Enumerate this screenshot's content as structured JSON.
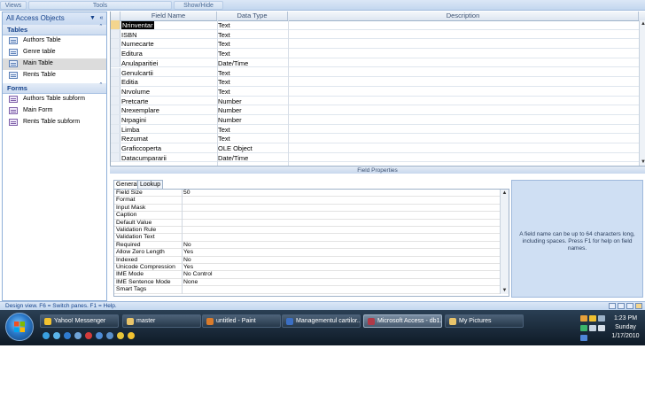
{
  "ribbon": {
    "groups": [
      "Views",
      "Tools",
      "Show/Hide"
    ]
  },
  "nav": {
    "title": "All Access Objects",
    "dropdown_icon": "chevron-down-icon",
    "collapse_icon": "double-chevron-left-icon",
    "groups": [
      {
        "label": "Tables",
        "items": [
          "Authors Table",
          "Genre table",
          "Main Table",
          "Rents Table"
        ]
      },
      {
        "label": "Forms",
        "items": [
          "Authors Table subform",
          "Main Form",
          "Rents Table subform"
        ]
      }
    ],
    "selected": "Main Table"
  },
  "grid": {
    "headers": {
      "field": "Field Name",
      "type": "Data Type",
      "desc": "Description"
    },
    "rows": [
      {
        "field": "Nrinventar",
        "type": "Text"
      },
      {
        "field": "ISBN",
        "type": "Text"
      },
      {
        "field": "Numecarte",
        "type": "Text"
      },
      {
        "field": "Editura",
        "type": "Text"
      },
      {
        "field": "Anulaparitiei",
        "type": "Date/Time"
      },
      {
        "field": "Genulcartii",
        "type": "Text"
      },
      {
        "field": "Editia",
        "type": "Text"
      },
      {
        "field": "Nrvolume",
        "type": "Text"
      },
      {
        "field": "Pretcarte",
        "type": "Number"
      },
      {
        "field": "Nrexemplare",
        "type": "Number"
      },
      {
        "field": "Nrpagini",
        "type": "Number"
      },
      {
        "field": "Limba",
        "type": "Text"
      },
      {
        "field": "Rezumat",
        "type": "Text"
      },
      {
        "field": "Graficcoperta",
        "type": "OLE Object"
      },
      {
        "field": "Datacumpararii",
        "type": "Date/Time"
      }
    ]
  },
  "field_properties": {
    "bar_title": "Field Properties",
    "tabs": [
      "General",
      "Lookup"
    ],
    "active_tab": "General",
    "props": [
      {
        "name": "Field Size",
        "value": "50"
      },
      {
        "name": "Format",
        "value": ""
      },
      {
        "name": "Input Mask",
        "value": ""
      },
      {
        "name": "Caption",
        "value": ""
      },
      {
        "name": "Default Value",
        "value": ""
      },
      {
        "name": "Validation Rule",
        "value": ""
      },
      {
        "name": "Validation Text",
        "value": ""
      },
      {
        "name": "Required",
        "value": "No"
      },
      {
        "name": "Allow Zero Length",
        "value": "Yes"
      },
      {
        "name": "Indexed",
        "value": "No"
      },
      {
        "name": "Unicode Compression",
        "value": "Yes"
      },
      {
        "name": "IME Mode",
        "value": "No Control"
      },
      {
        "name": "IME Sentence Mode",
        "value": "None"
      },
      {
        "name": "Smart Tags",
        "value": ""
      }
    ],
    "help_text": "A field name can be up to 64 characters long, including spaces. Press F1 for help on field names."
  },
  "status_bar": {
    "text": "Design view.  F6 = Switch panes.  F1 = Help."
  },
  "taskbar": {
    "buttons": [
      {
        "label": "Yahoo! Messenger",
        "icon": "yahoo-messenger-icon",
        "color": "#f2c230"
      },
      {
        "label": "master",
        "icon": "folder-icon",
        "color": "#e9c46a"
      },
      {
        "label": "untitled - Paint",
        "icon": "paint-icon",
        "color": "#d97b2b"
      },
      {
        "label": "Managementul cartilor...",
        "icon": "word-document-icon",
        "color": "#3b6fc4"
      },
      {
        "label": "Microsoft Access - db1...",
        "icon": "access-icon",
        "color": "#b03a48"
      },
      {
        "label": "My Pictures",
        "icon": "folder-icon",
        "color": "#e9c46a"
      }
    ],
    "active": "Microsoft Access - db1...",
    "clock": {
      "time": "1:23 PM",
      "day": "Sunday",
      "date": "1/17/2010"
    }
  }
}
